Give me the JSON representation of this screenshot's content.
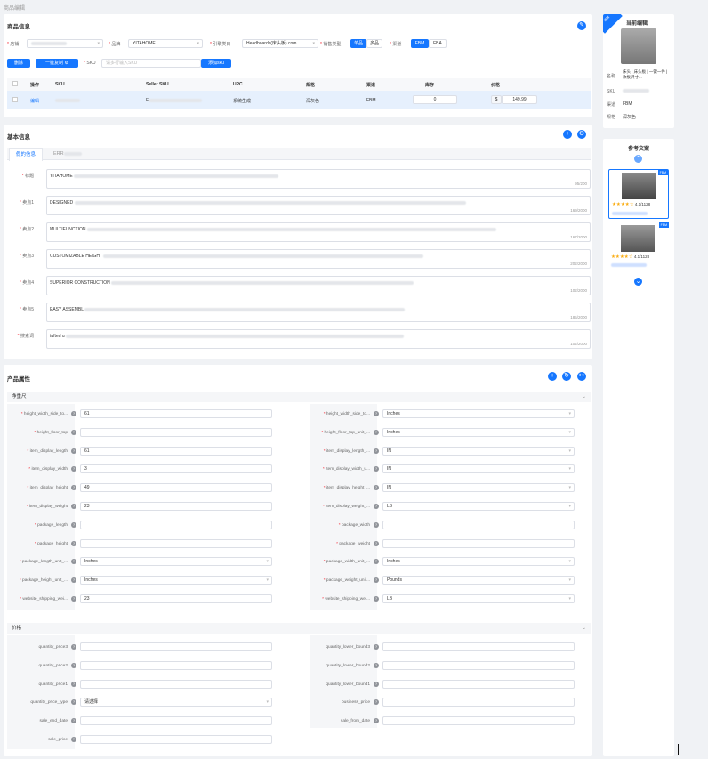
{
  "breadcrumb": "商品编辑",
  "info": {
    "title": "商品信息",
    "shop_label": "店铺",
    "brand_label": "品牌",
    "brand_value": "YITAHOME",
    "category_label": "引擎类目",
    "category_value": "Headboards(床头板).com",
    "sale_type_label": "销售类型",
    "sale_type_a": "单品",
    "sale_type_b": "多品",
    "channel_label": "渠道",
    "channel_a": "FBM",
    "channel_b": "FBA",
    "delete_btn": "删除",
    "copy_btn": "一键复制",
    "sku_label": "SKU",
    "sku_placeholder": "请多行输入SKU",
    "add_sku_btn": "添加sku",
    "columns": [
      "操作",
      "SKU",
      "Seller SKU",
      "UPC",
      "规格",
      "渠道",
      "库存",
      "价格"
    ],
    "row": {
      "action": "编辑",
      "seller_sku": "F",
      "upc": "系统生成",
      "spec": "深灰色",
      "channel": "FBM",
      "stock": "0",
      "currency": "$",
      "price": "149.99"
    }
  },
  "basic": {
    "title": "基本信息",
    "tab_active": "假的信息",
    "tab_other": "ERR",
    "fields": [
      {
        "label": "标题",
        "text": "YITAHOME",
        "count": "95/200"
      },
      {
        "label": "卖点1",
        "text": "DESIGNED",
        "count": "169/2000"
      },
      {
        "label": "卖点2",
        "text": "MULTIFUNCTION",
        "count": "167/2000"
      },
      {
        "label": "卖点3",
        "text": "CUSTOMIZABLE HEIGHT",
        "count": "202/2000"
      },
      {
        "label": "卖点4",
        "text": "SUPERIOR CONSTRUCTION",
        "count": "102/2000"
      },
      {
        "label": "卖点5",
        "text": "EASY ASSEMBL",
        "count": "185/2000"
      },
      {
        "label": "搜索词",
        "text": "tufted u",
        "count": "102/2000"
      }
    ]
  },
  "attrs": {
    "title": "产品属性",
    "group1": "净重尺",
    "group2": "价格",
    "g1": [
      {
        "l": "height_width_side_to...",
        "v": "61",
        "r": "height_width_side_to...",
        "rv": "Inches",
        "rs": true
      },
      {
        "l": "height_floor_top",
        "v": "",
        "r": "height_floor_top_unit_...",
        "rv": "Inches",
        "rs": true
      },
      {
        "l": "item_display_length",
        "v": "61",
        "r": "item_display_length_...",
        "rv": "IN",
        "rs": true
      },
      {
        "l": "item_display_width",
        "v": "3",
        "r": "item_display_width_u...",
        "rv": "IN",
        "rs": true
      },
      {
        "l": "item_display_height",
        "v": "49",
        "r": "item_display_height_...",
        "rv": "IN",
        "rs": true
      },
      {
        "l": "item_display_weight",
        "v": "23",
        "r": "item_display_weight_...",
        "rv": "LB",
        "rs": true
      },
      {
        "l": "package_length",
        "v": "",
        "r": "package_width",
        "rv": "",
        "rs": false
      },
      {
        "l": "package_height",
        "v": "",
        "r": "package_weight",
        "rv": "",
        "rs": false
      },
      {
        "l": "package_length_unit_...",
        "v": "Inches",
        "ls": true,
        "r": "package_width_unit_...",
        "rv": "Inches",
        "rs": true
      },
      {
        "l": "package_height_unit_...",
        "v": "Inches",
        "ls": true,
        "r": "package_weight_unit...",
        "rv": "Pounds",
        "rs": true
      },
      {
        "l": "website_shipping_wei...",
        "v": "23",
        "r": "website_shipping_wei...",
        "rv": "LB",
        "rs": true
      }
    ],
    "g2": [
      {
        "l": "quantity_price3",
        "v": "",
        "r": "quantity_lower_bound3",
        "rv": ""
      },
      {
        "l": "quantity_price2",
        "v": "",
        "r": "quantity_lower_bound2",
        "rv": ""
      },
      {
        "l": "quantity_price1",
        "v": "",
        "r": "quantity_lower_bound1",
        "rv": ""
      },
      {
        "l": "quantity_price_type",
        "v": "请选择",
        "ls": true,
        "r": "business_price",
        "rv": ""
      },
      {
        "l": "sale_end_date",
        "v": "",
        "r": "sale_from_date",
        "rv": ""
      },
      {
        "l": "sale_price",
        "v": "",
        "r": null,
        "rv": ""
      }
    ]
  },
  "side": {
    "title": "当前编辑",
    "badge": "编辑",
    "name_label": "名称",
    "name_value": "床头 | 床头板 | 一键一件 | 款板尺寸...",
    "sku_label": "SKU",
    "channel_label": "渠道",
    "channel_value": "FBM",
    "spec_label": "规格",
    "spec_value": "深灰色",
    "ref_title": "参考文案",
    "ref1_badge": "FBM",
    "ref1_rating": "4.1/1128",
    "ref2_badge": "FBM",
    "ref2_rating": "4.1/1128"
  }
}
